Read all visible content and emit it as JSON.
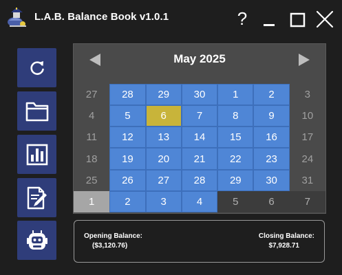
{
  "window": {
    "title": "L.A.B. Balance Book v1.0.1",
    "help_label": "?"
  },
  "sidebar": {
    "items": [
      {
        "name": "refresh",
        "icon": "refresh-icon"
      },
      {
        "name": "open-folder",
        "icon": "folder-icon"
      },
      {
        "name": "reports",
        "icon": "bar-chart-icon"
      },
      {
        "name": "edit",
        "icon": "edit-document-icon"
      },
      {
        "name": "assistant",
        "icon": "robot-icon"
      }
    ]
  },
  "calendar": {
    "month_label": "May 2025",
    "prev_icon": "triangle-left-icon",
    "next_icon": "triangle-right-icon",
    "weeks": [
      [
        "27",
        "28",
        "29",
        "30",
        "1",
        "2",
        "3"
      ],
      [
        "4",
        "5",
        "6",
        "7",
        "8",
        "9",
        "10"
      ],
      [
        "11",
        "12",
        "13",
        "14",
        "15",
        "16",
        "17"
      ],
      [
        "18",
        "19",
        "20",
        "21",
        "22",
        "23",
        "24"
      ],
      [
        "25",
        "26",
        "27",
        "28",
        "29",
        "30",
        "31"
      ],
      [
        "1",
        "2",
        "3",
        "4",
        "5",
        "6",
        "7"
      ]
    ],
    "selected_day": "6"
  },
  "balance": {
    "opening_label": "Opening Balance:",
    "opening_value": "($3,120.76)",
    "closing_label": "Closing Balance:",
    "closing_value": "$7,928.71"
  },
  "colors": {
    "background": "#1e1e1e",
    "sidebar_button": "#2f3d7a",
    "calendar_bg": "#4a4a4a",
    "in_month_day": "#4f86d6",
    "selected_day": "#c8b43a"
  }
}
